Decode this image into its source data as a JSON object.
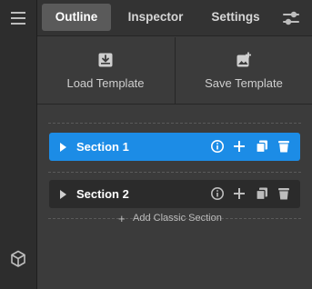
{
  "rail": {
    "menu_icon": "hamburger-icon",
    "bottom_icon": "cube-icon"
  },
  "tabs": [
    {
      "label": "Outline",
      "active": true
    },
    {
      "label": "Inspector",
      "active": false
    },
    {
      "label": "Settings",
      "active": false
    }
  ],
  "tab_settings_icon": "sliders-icon",
  "templates": {
    "load_label": "Load Template",
    "load_icon": "download-tray-icon",
    "save_label": "Save Template",
    "save_icon": "image-plus-icon"
  },
  "sections": [
    {
      "name": "Section 1",
      "selected": true,
      "tools": [
        "info-icon",
        "plus-icon",
        "duplicate-icon",
        "trash-icon"
      ]
    },
    {
      "name": "Section 2",
      "selected": false,
      "tools": [
        "info-icon",
        "plus-icon",
        "duplicate-icon",
        "trash-icon"
      ]
    }
  ],
  "add_section": {
    "plus": "+",
    "label": "Add Classic Section"
  },
  "colors": {
    "selected": "#1c8ce6",
    "background": "#3b3b3b",
    "rail": "#2d2d2d"
  }
}
